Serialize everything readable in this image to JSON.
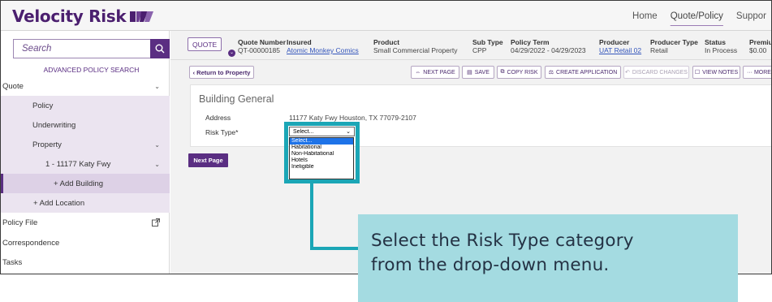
{
  "header": {
    "logo_text": "Velocity Risk",
    "nav": [
      "Home",
      "Quote/Policy",
      "Suppor"
    ],
    "active_nav": "Quote/Policy",
    "brand_color": "#4b1f6f"
  },
  "sidebar": {
    "search_placeholder": "Search",
    "search_icon": "search-icon",
    "advanced_search": "ADVANCED POLICY SEARCH",
    "items": [
      {
        "label": "Quote",
        "chevron": true
      },
      {
        "label": "Policy",
        "chevron": false
      },
      {
        "label": "Underwriting",
        "chevron": false
      },
      {
        "label": "Property",
        "chevron": true
      },
      {
        "label": "1 - 11177 Katy Fwy",
        "chevron": true
      },
      {
        "label": "+ Add Building",
        "chevron": false
      },
      {
        "label": "+ Add Location",
        "chevron": false
      },
      {
        "label": "Policy File",
        "icon": "external-link-icon"
      },
      {
        "label": "Correspondence"
      },
      {
        "label": "Tasks"
      }
    ]
  },
  "quote_bar": {
    "tag": "QUOTE",
    "columns": [
      {
        "header": "Quote Number",
        "value": "QT-00000185"
      },
      {
        "header": "Insured",
        "value": "Atomic Monkey Comics"
      },
      {
        "header": "Product",
        "value": "Small Commercial Property"
      },
      {
        "header": "Sub Type",
        "value": "CPP"
      },
      {
        "header": "Policy Term",
        "value": "04/29/2022 - 04/29/2023"
      },
      {
        "header": "Producer",
        "value": "UAT Retail 02"
      },
      {
        "header": "Producer Type",
        "value": "Retail"
      },
      {
        "header": "Status",
        "value": "In Process"
      },
      {
        "header": "Premiun",
        "value": "$0.00"
      }
    ]
  },
  "toolbar": {
    "return": "‹ Return to Property",
    "next_page": "NEXT PAGE",
    "save": "SAVE",
    "copy_risk": "COPY RISK",
    "create_application": "CREATE APPLICATION",
    "discard_changes": "DISCARD CHANGES",
    "view_notes": "VIEW NOTES",
    "more": "··· MORE"
  },
  "building_general": {
    "title": "Building General",
    "address_label": "Address",
    "address_value": "11177 Katy Fwy Houston, TX 77079-2107",
    "risk_type_label": "Risk Type*",
    "risk_type_selected": "Select...",
    "risk_type_options": [
      "Select...",
      "Habitational",
      "Non-Habitational",
      "Hotels",
      "Ineligible"
    ]
  },
  "next_page_button": "Next Page",
  "callout": {
    "line1": "Select the Risk Type category",
    "line2": "from the drop-down menu.",
    "accent_color": "#1ba6b6",
    "background_color": "#a4dbe1"
  }
}
